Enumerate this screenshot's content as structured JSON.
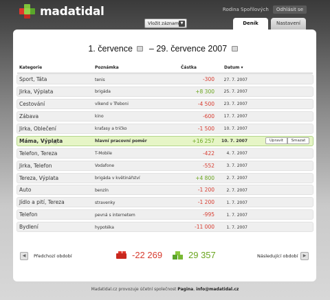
{
  "brand": {
    "name": "madatidal"
  },
  "user": {
    "name": "Rodina Spořilových",
    "logout_label": "Odhlásit se"
  },
  "toolbar": {
    "add_label": "Vložit záznam"
  },
  "tabs": [
    {
      "label": "Deník",
      "active": true
    },
    {
      "label": "Nastavení",
      "active": false
    }
  ],
  "period": {
    "from": "1. července",
    "separator": "–",
    "to": "29. července 2007"
  },
  "table": {
    "headers": {
      "category": "Kategorie",
      "note": "Poznámka",
      "amount": "Částka",
      "date": "Datum ▾"
    },
    "rows": [
      {
        "category": "Sport, Táta",
        "note": "tenis",
        "amount": "-300",
        "date": "27. 7. 2007",
        "sign": "neg"
      },
      {
        "category": "Jirka, Výplata",
        "note": "brigáda",
        "amount": "+8 300",
        "date": "25. 7. 2007",
        "sign": "pos"
      },
      {
        "category": "Cestování",
        "note": "víkend v Třeboni",
        "amount": "-4 500",
        "date": "23. 7. 2007",
        "sign": "neg"
      },
      {
        "category": "Zábava",
        "note": "kino",
        "amount": "-600",
        "date": "17. 7. 2007",
        "sign": "neg"
      },
      {
        "category": "Jirka, Oblečení",
        "note": "kraťasy a tričko",
        "amount": "-1 500",
        "date": "10. 7. 2007",
        "sign": "neg"
      },
      {
        "category": "Máma, Výplata",
        "note": "hlavní pracovní poměr",
        "amount": "+16 257",
        "date": "10. 7. 2007",
        "sign": "pos",
        "highlight": true
      },
      {
        "category": "Telefon, Tereza",
        "note": "T-Mobile",
        "amount": "-422",
        "date": "4. 7. 2007",
        "sign": "neg"
      },
      {
        "category": "Jirka, Telefon",
        "note": "Vodafone",
        "amount": "-552",
        "date": "3. 7. 2007",
        "sign": "neg"
      },
      {
        "category": "Tereza, Výplata",
        "note": "brigáda v květinářství",
        "amount": "+4 800",
        "date": "2. 7. 2007",
        "sign": "pos"
      },
      {
        "category": "Auto",
        "note": "benzín",
        "amount": "-1 200",
        "date": "2. 7. 2007",
        "sign": "neg"
      },
      {
        "category": "Jídlo a pití, Tereza",
        "note": "stravenky",
        "amount": "-1 200",
        "date": "1. 7. 2007",
        "sign": "neg"
      },
      {
        "category": "Telefon",
        "note": "pevná s internetem",
        "amount": "-995",
        "date": "1. 7. 2007",
        "sign": "neg"
      },
      {
        "category": "Bydlení",
        "note": "hypotéka",
        "amount": "-11 000",
        "date": "1. 7. 2007",
        "sign": "neg"
      }
    ],
    "row_actions": {
      "edit": "Upravit",
      "delete": "Smazat"
    }
  },
  "summary": {
    "expenses": "-22 269",
    "income": "29 357"
  },
  "nav": {
    "prev_label": "Předchozí období",
    "next_label": "Následující období"
  },
  "footer": {
    "text": "Madatidal.cz provozuje účetní společnost",
    "company": "Pagina",
    "separator": ",",
    "email": "info@madatidal.cz"
  },
  "colors": {
    "negative": "#d73a2e",
    "positive": "#6aa51e",
    "highlight_row": "#e6f5c6"
  },
  "icons": {
    "calendar": "calendar-icon",
    "prev": "chevron-left-icon",
    "next": "chevron-right-icon",
    "dropdown": "chevron-down-icon"
  }
}
